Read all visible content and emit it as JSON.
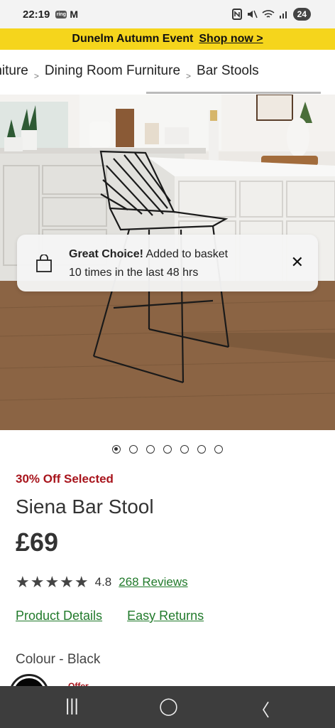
{
  "status_bar": {
    "time": "22:19",
    "notif_badge": "ring",
    "mail_icon": "M",
    "battery": "24"
  },
  "banner": {
    "text": "Dunelm Autumn Event",
    "link": "Shop now >"
  },
  "breadcrumb": {
    "item1": "rniture",
    "item2": "Dining Room Furniture",
    "item3": "Bar Stools"
  },
  "toast": {
    "bold": "Great Choice!",
    "text1": "Added to basket",
    "text2": "10 times in the last 48 hrs",
    "close": "✕"
  },
  "gallery": {
    "image_count": 7,
    "active_index": 0
  },
  "product": {
    "promo": "30% Off Selected",
    "title": "Siena Bar Stool",
    "price": "£69",
    "stars": "★★★★★",
    "rating": "4.8",
    "reviews": "268 Reviews",
    "details_link": "Product Details",
    "returns_link": "Easy Returns",
    "colour_label": "Colour - Black",
    "offer_label": "Offer"
  },
  "nav": {
    "recents": "|||",
    "home": "◯",
    "back": "〈"
  }
}
